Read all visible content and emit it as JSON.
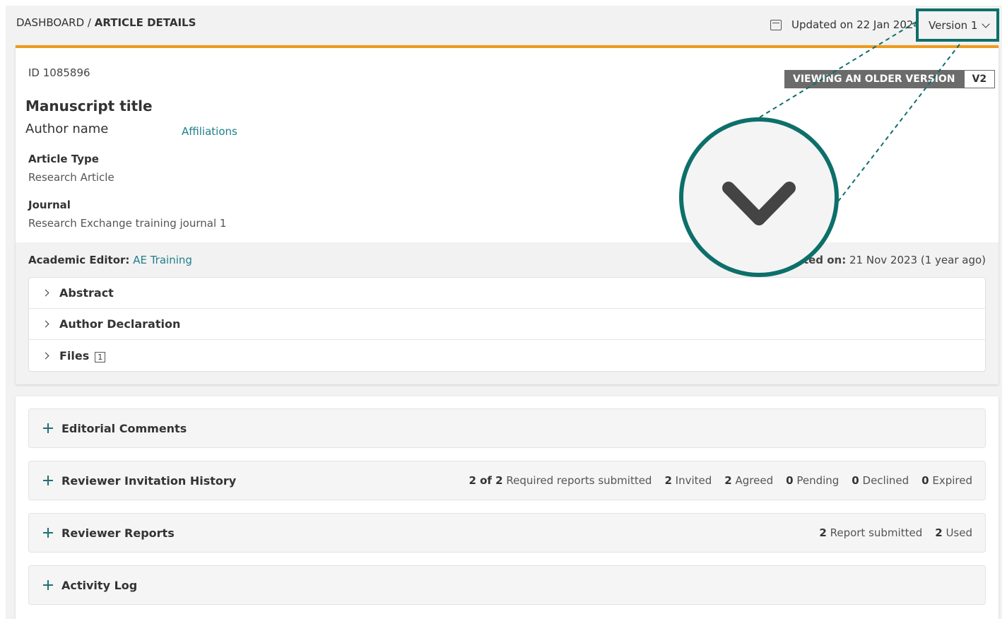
{
  "breadcrumb": {
    "root": "DASHBOARD",
    "separator": " / ",
    "current": "ARTICLE DETAILS"
  },
  "header": {
    "updated_text": "Updated on 22 Jan 2024",
    "version_label": "Version 1",
    "icon": "calendar-icon"
  },
  "article": {
    "id_text": "ID 1085896",
    "viewing_badge": "VIEWING AN OLDER VERSION",
    "version_badge": "V2",
    "title": "Manuscript title",
    "author": "Author name",
    "affiliations_link": "Affiliations",
    "type_label": "Article Type",
    "type_value": "Research Article",
    "journal_label": "Journal",
    "journal_value": "Research Exchange training journal 1",
    "editor_label": "Academic Editor:",
    "editor_name": "AE Training",
    "submitted_label": "Submitted on:",
    "submitted_value": "21 Nov 2023 (1 year ago)"
  },
  "sections": [
    {
      "label": "Abstract"
    },
    {
      "label": "Author Declaration"
    },
    {
      "label": "Files",
      "count": "1"
    }
  ],
  "panels": {
    "editorial": {
      "title": "Editorial Comments"
    },
    "invitations": {
      "title": "Reviewer Invitation History",
      "submitted_num": "2 of 2",
      "submitted_text": "Required reports submitted",
      "invited_num": "2",
      "invited_text": "Invited",
      "agreed_num": "2",
      "agreed_text": "Agreed",
      "pending_num": "0",
      "pending_text": "Pending",
      "declined_num": "0",
      "declined_text": "Declined",
      "expired_num": "0",
      "expired_text": "Expired"
    },
    "reports": {
      "title": "Reviewer Reports",
      "submitted_num": "2",
      "submitted_text": "Report submitted",
      "used_num": "2",
      "used_text": "Used"
    },
    "activity": {
      "title": "Activity Log"
    }
  },
  "colors": {
    "accent": "#0d6f6a",
    "highlight_bar": "#f09a1a",
    "link": "#1f7f8a",
    "badge": "#6b6b6b"
  }
}
